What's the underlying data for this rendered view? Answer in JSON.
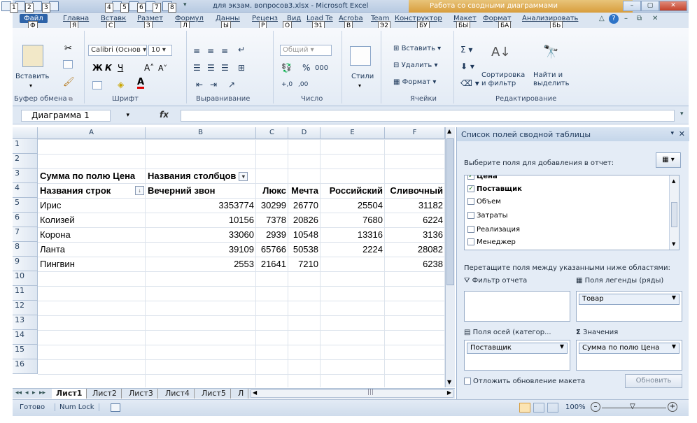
{
  "window": {
    "title": "для экзам. вопросов3.xlsx - Microsoft Excel",
    "context_title": "Работа со сводными диаграммами",
    "quick_access_keytips": [
      "1",
      "2",
      "3",
      "4",
      "5",
      "6",
      "7",
      "8"
    ]
  },
  "tabs": [
    {
      "label": "Файл",
      "keytip": "Ф"
    },
    {
      "label": "Главна",
      "keytip": "Я"
    },
    {
      "label": "Вставк",
      "keytip": "С"
    },
    {
      "label": "Размет",
      "keytip": "З"
    },
    {
      "label": "Формул",
      "keytip": "Л"
    },
    {
      "label": "Данны",
      "keytip": "Ы"
    },
    {
      "label": "Реценз",
      "keytip": "Р"
    },
    {
      "label": "Вид",
      "keytip": "О"
    },
    {
      "label": "Load Te",
      "keytip": "Э1"
    },
    {
      "label": "Acroba",
      "keytip": "В"
    },
    {
      "label": "Team",
      "keytip": "Э2"
    },
    {
      "label": "Конструктор",
      "keytip": "БУ"
    },
    {
      "label": "Макет",
      "keytip": "БЫ"
    },
    {
      "label": "Формат",
      "keytip": "БА"
    },
    {
      "label": "Анализировать",
      "keytip": "БЬ"
    }
  ],
  "ribbon": {
    "paste": "Вставить",
    "font_name": "Calibri (Основ",
    "font_size": "10",
    "number_format": "Общий",
    "styles": "Стили",
    "insert": "Вставить",
    "delete": "Удалить",
    "format": "Формат",
    "sort_filter_1": "Сортировка",
    "sort_filter_2": "и фильтр",
    "find_select_1": "Найти и",
    "find_select_2": "выделить",
    "groups": {
      "clipboard": "Буфер обмена",
      "font": "Шрифт",
      "alignment": "Выравнивание",
      "number": "Число",
      "cells": "Ячейки",
      "editing": "Редактирование"
    }
  },
  "formula_bar": {
    "name_box": "Диаграмма 1",
    "fx": "fx",
    "formula": ""
  },
  "sheet": {
    "columns": [
      "A",
      "B",
      "C",
      "D",
      "E",
      "F"
    ],
    "rows": [
      "1",
      "2",
      "3",
      "4",
      "5",
      "6",
      "7",
      "8",
      "9",
      "10",
      "11",
      "12",
      "13",
      "14",
      "15",
      "16"
    ],
    "pivot": {
      "sum_label": "Сумма по полю Цена",
      "col_labels": "Названия столбцов",
      "row_labels": "Названия строк",
      "headers": [
        "Вечерний звон",
        "Люкс",
        "Мечта",
        "Российский",
        "Сливочный"
      ],
      "data": [
        {
          "name": "Ирис",
          "values": [
            "3353774",
            "30299",
            "26770",
            "25504",
            "31182"
          ]
        },
        {
          "name": "Колизей",
          "values": [
            "10156",
            "7378",
            "20826",
            "7680",
            "6224"
          ]
        },
        {
          "name": "Корона",
          "values": [
            "33060",
            "2939",
            "10548",
            "13316",
            "3136"
          ]
        },
        {
          "name": "Ланта",
          "values": [
            "39109",
            "65766",
            "50538",
            "2224",
            "28082"
          ]
        },
        {
          "name": "Пингвин",
          "values": [
            "2553",
            "21641",
            "7210",
            "",
            "6238"
          ]
        }
      ]
    }
  },
  "sheet_tabs": [
    "Лист1",
    "Лист2",
    "Лист3",
    "Лист4",
    "Лист5",
    "Л"
  ],
  "status": {
    "ready": "Готово",
    "num_lock": "Num Lock",
    "zoom": "100%"
  },
  "field_pane": {
    "title": "Список полей сводной таблицы",
    "choose_fields": "Выберите поля для добавления в отчет:",
    "fields": [
      {
        "name": "Цена",
        "checked": true
      },
      {
        "name": "Поставщик",
        "checked": true
      },
      {
        "name": "Объем",
        "checked": false
      },
      {
        "name": "Затраты",
        "checked": false
      },
      {
        "name": "Реализация",
        "checked": false
      },
      {
        "name": "Менеджер",
        "checked": false
      }
    ],
    "drag_hint": "Перетащите поля между указанными ниже областями:",
    "report_filter": "Фильтр отчета",
    "legend_fields": "Поля легенды (ряды)",
    "legend_value": "Товар",
    "axis_fields": "Поля осей (категор...",
    "values": "Значения",
    "axis_value": "Поставщик",
    "values_value": "Сумма по полю Цена",
    "defer_update": "Отложить обновление макета",
    "update": "Обновить"
  }
}
